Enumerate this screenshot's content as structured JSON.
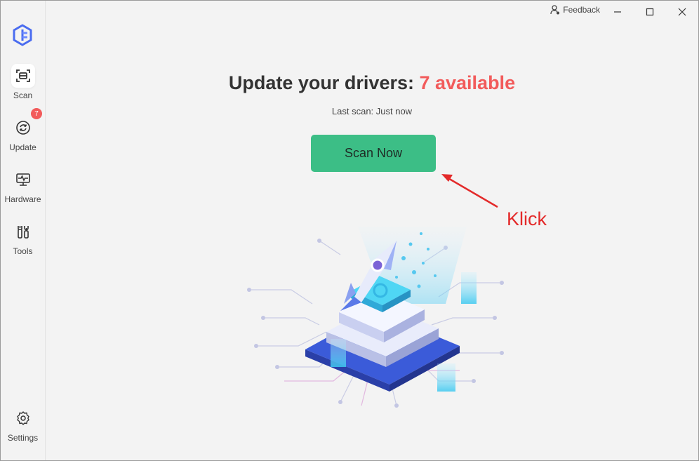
{
  "window": {
    "feedback_label": "Feedback"
  },
  "sidebar": {
    "items": [
      {
        "label": "Scan",
        "icon": "scan-icon",
        "active": true
      },
      {
        "label": "Update",
        "icon": "refresh-icon",
        "badge": "7"
      },
      {
        "label": "Hardware",
        "icon": "monitor-pulse-icon"
      },
      {
        "label": "Tools",
        "icon": "tools-icon"
      }
    ],
    "settings_label": "Settings"
  },
  "main": {
    "headline_prefix": "Update your drivers: ",
    "headline_count": "7 available",
    "last_scan": "Last scan: Just now",
    "scan_button": "Scan Now"
  },
  "annotation": {
    "text": "Klick"
  },
  "colors": {
    "accent_green": "#3cbe86",
    "alert_red": "#f25b5b",
    "annotation_red": "#e32a2a",
    "brand_blue": "#4a6cf0"
  }
}
